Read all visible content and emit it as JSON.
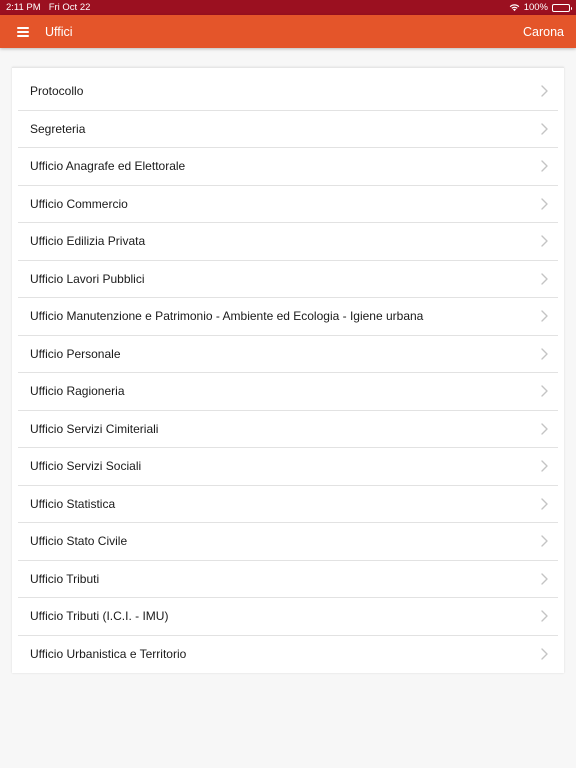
{
  "status_bar": {
    "time": "2:11 PM",
    "date": "Fri Oct 22",
    "battery": "100%"
  },
  "app_bar": {
    "title": "Uffici",
    "action": "Carona"
  },
  "offices": [
    "Protocollo",
    "Segreteria",
    "Ufficio Anagrafe ed Elettorale",
    "Ufficio Commercio",
    "Ufficio Edilizia Privata",
    "Ufficio Lavori Pubblici",
    "Ufficio Manutenzione e Patrimonio - Ambiente ed Ecologia - Igiene urbana",
    "Ufficio Personale",
    "Ufficio Ragioneria",
    "Ufficio Servizi Cimiteriali",
    "Ufficio Servizi Sociali",
    "Ufficio Statistica",
    "Ufficio Stato Civile",
    "Ufficio Tributi",
    "Ufficio Tributi (I.C.I. - IMU)",
    "Ufficio Urbanistica e Territorio"
  ],
  "colors": {
    "status_bar": "#9b1020",
    "app_bar": "#e4552a",
    "background": "#f7f7f7"
  }
}
